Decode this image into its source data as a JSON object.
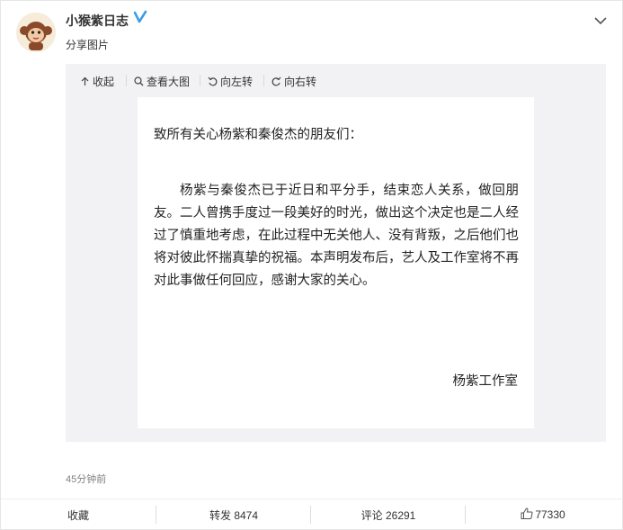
{
  "post": {
    "username": "小猴紫日志",
    "subtitle": "分享图片",
    "timestamp": "45分钟前"
  },
  "toolbar": {
    "collapse": "收起",
    "view_large": "查看大图",
    "rotate_left": "向左转",
    "rotate_right": "向右转"
  },
  "letter": {
    "greeting": "致所有关心杨紫和秦俊杰的朋友们：",
    "body": "杨紫与秦俊杰已于近日和平分手，结束恋人关系，做回朋友。二人曾携手度过一段美好的时光，做出这个决定也是二人经过了慎重地考虑，在此过程中无关他人、没有背叛，之后他们也将对彼此怀揣真挚的祝福。本声明发布后，艺人及工作室将不再对此事做任何回应，感谢大家的关心。",
    "signature": "杨紫工作室"
  },
  "actions": {
    "favorite": "收藏",
    "repost": "转发 8474",
    "comment": "评论 26291",
    "like": "77330"
  },
  "colors": {
    "verified": "#3d9ee8",
    "panel_bg": "#f2f2f5"
  },
  "icons": [
    "avatar",
    "verified-badge-icon",
    "chevron-down-icon",
    "collapse-arrow-icon",
    "magnifier-icon",
    "rotate-left-icon",
    "rotate-right-icon",
    "thumbs-up-icon"
  ]
}
